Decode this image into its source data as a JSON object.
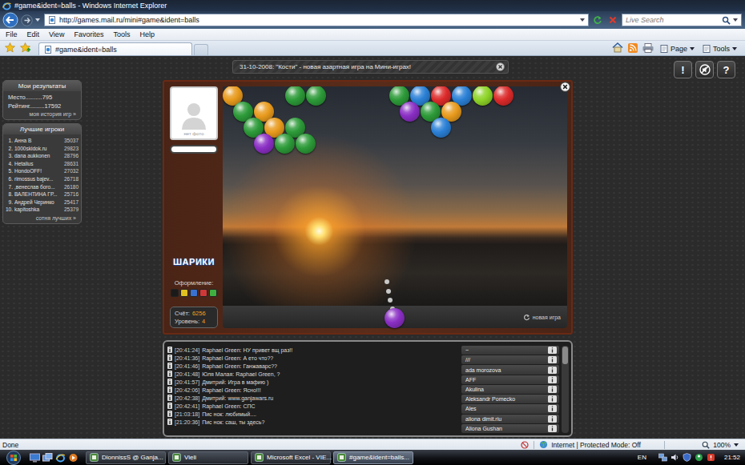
{
  "window": {
    "title": "#game&ident=balls - Windows Internet Explorer"
  },
  "address_bar": {
    "url": "http://games.mail.ru/mini#game&ident=balls",
    "search_placeholder": "Live Search"
  },
  "menu": [
    "File",
    "Edit",
    "View",
    "Favorites",
    "Tools",
    "Help"
  ],
  "tabs": [
    {
      "label": "#game&ident=balls",
      "selected": true
    }
  ],
  "toolbar": [
    {
      "label": "Page"
    },
    {
      "label": "Tools"
    }
  ],
  "page": {
    "news": "31-10-2008: \"Кости\" - новая азартная игра на Мини-играх!",
    "top_buttons": [
      {
        "kind": "text",
        "label": "!"
      },
      {
        "kind": "icon",
        "label": ""
      },
      {
        "kind": "text",
        "label": "?"
      }
    ],
    "my_results": {
      "title": "Мои результаты",
      "rows": [
        {
          "label": "Место..........",
          "value": "795"
        },
        {
          "label": "Рейтинг.........",
          "value": "17592"
        }
      ],
      "link": "моя история игр »"
    },
    "top_players": {
      "title": "Лучшие игроки",
      "rows": [
        {
          "rank": "1.",
          "name": "Анна В",
          "score": "35037"
        },
        {
          "rank": "2.",
          "name": "1000skidok.ru",
          "score": "29823"
        },
        {
          "rank": "3.",
          "name": "dana aukkonen",
          "score": "28796"
        },
        {
          "rank": "4.",
          "name": "Hetalius",
          "score": "28631"
        },
        {
          "rank": "5.",
          "name": "HondoOFF!",
          "score": "27032"
        },
        {
          "rank": "6.",
          "name": "rimossus bajev...",
          "score": "26718"
        },
        {
          "rank": "7.",
          "name": ",венеслав бого...",
          "score": "26180"
        },
        {
          "rank": "8.",
          "name": "ВАЛЕНТИНА ГР...",
          "score": "25716"
        },
        {
          "rank": "9.",
          "name": "Андрей Черинко",
          "score": "25417"
        },
        {
          "rank": "10.",
          "name": "kapitoshka",
          "score": "25379"
        }
      ],
      "link": "сотня лучших »"
    },
    "game": {
      "avatar_caption": "нет фото",
      "logo": "ШАРИКИ",
      "theme_label": "Оформление:",
      "themes": [
        {
          "color": "#1a1a1a"
        },
        {
          "color": "#e0c020"
        },
        {
          "color": "#3a70d0"
        },
        {
          "color": "#d03838"
        },
        {
          "color": "#40b040"
        }
      ],
      "score": {
        "label": "Счёт:",
        "value": "6256"
      },
      "level": {
        "label": "Уровень:",
        "value": "4"
      },
      "board": [
        {
          "cells": [
            "#e89a1c",
            "",
            "",
            "#2c9a38",
            "#2c9a38",
            "",
            "",
            "",
            "#2c9a38",
            "#2a80d6",
            "#dc2a2a",
            "#2a80d6",
            "#8ed428",
            "#dc2a2a",
            "",
            ""
          ]
        },
        {
          "cells": [
            "#2c9a38",
            "#e89a1c",
            "",
            "",
            "",
            "",
            "",
            "",
            "#8a2ec4",
            "#2c9a38",
            "#e89a1c",
            "",
            "",
            "",
            "",
            ""
          ]
        },
        {
          "cells": [
            "",
            "#2c9a38",
            "#e89a1c",
            "#2c9a38",
            "",
            "",
            "",
            "",
            "",
            "",
            "#2a80d6",
            "",
            "",
            "",
            "",
            ""
          ]
        },
        {
          "cells": [
            "",
            "#8a2ec4",
            "#2c9a38",
            "#2c9a38",
            "",
            "",
            "",
            "",
            "",
            "",
            "",
            "",
            "",
            "",
            "",
            ""
          ]
        }
      ],
      "shooter": {
        "color": "#8a2ec4"
      },
      "new_game": "новая игра"
    },
    "chat": {
      "messages": [
        {
          "time": "[20:41:24]",
          "text": "Raphael Green: НУ привет вщ раз!!"
        },
        {
          "time": "[20:41:36]",
          "text": "Raphael Green: А ето что??"
        },
        {
          "time": "[20:41:46]",
          "text": "Raphael Green: Ганжаварс??"
        },
        {
          "time": "[20:41:48]",
          "text": "Юля Малая: Raphael Green, ?"
        },
        {
          "time": "[20:41:57]",
          "text": "Дмитрий: Игра в мафию )"
        },
        {
          "time": "[20:42:06]",
          "text": "Raphael Green: Ясно!!!"
        },
        {
          "time": "[20:42:38]",
          "text": "Дмитрий: www.ganjawars.ru"
        },
        {
          "time": "[20:42:41]",
          "text": "Raphael Green: СПС"
        },
        {
          "time": "[21:03:18]",
          "text": "Пис нок: любимый...."
        },
        {
          "time": "[21:20:36]",
          "text": "Пис нок: саш, ты здесь?"
        }
      ],
      "users": [
        "~",
        "///",
        "ada morozova",
        "AFF",
        "Akulina",
        "Aleksandr Pomecko",
        "Ales",
        "aliona dimit.riu",
        "Aliona Gushan"
      ]
    }
  },
  "status_bar": {
    "text": "Done",
    "zone": "Internet | Protected Mode: Off",
    "zoom": "100%"
  },
  "taskbar": {
    "tasks": [
      {
        "label": "DionnissS @ Ganja...",
        "selected": false
      },
      {
        "label": "Vieli",
        "selected": false
      },
      {
        "label": "Microsoft Excel - VIE...",
        "selected": false
      },
      {
        "label": "#game&ident=balls...",
        "selected": true
      }
    ],
    "language": "EN",
    "clock": "21:52"
  }
}
